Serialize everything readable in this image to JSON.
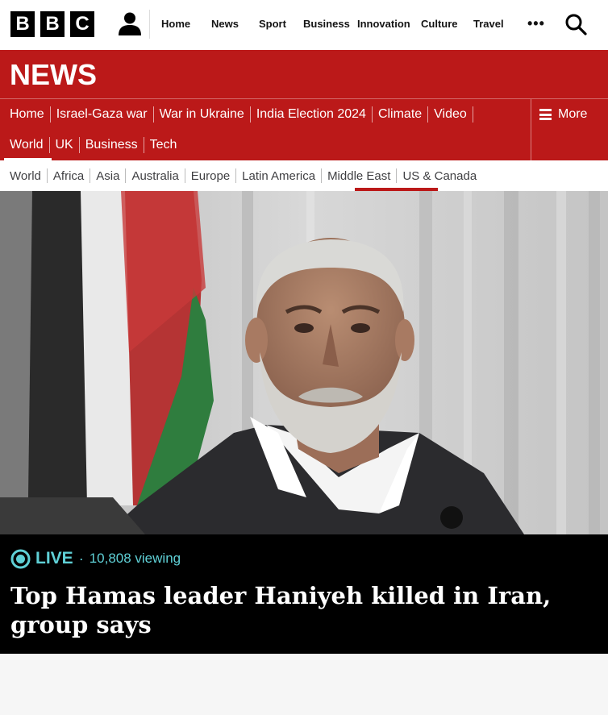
{
  "brand": {
    "letters": [
      "B",
      "B",
      "C"
    ]
  },
  "top_nav": {
    "items": [
      "Home",
      "News",
      "Sport",
      "Business",
      "Innovation",
      "Culture",
      "Travel"
    ],
    "more": "•••"
  },
  "news_header": {
    "wordmark": "NEWS"
  },
  "primary_nav": {
    "row1": [
      "Home",
      "Israel-Gaza war",
      "War in Ukraine",
      "India Election 2024",
      "Climate",
      "Video"
    ],
    "row2": [
      "World",
      "UK",
      "Business",
      "Tech"
    ],
    "active": "World",
    "more_label": "More"
  },
  "secondary_nav": {
    "items": [
      "World",
      "Africa",
      "Asia",
      "Australia",
      "Europe",
      "Latin America",
      "Middle East",
      "US & Canada"
    ],
    "active": "Middle East"
  },
  "hero": {
    "image_subject": "portrait photo of a man with grey hair and beard in dark suit, flag in background"
  },
  "story": {
    "live_label": "LIVE",
    "separator": "·",
    "viewing": "10,808 viewing",
    "headline": "Top Hamas leader Haniyeh killed in Iran, group says"
  },
  "colors": {
    "bbc_red": "#bb1919",
    "live_teal": "#5fd0d6",
    "caption_bg": "#000000"
  },
  "icons": [
    "account-icon",
    "search-icon",
    "hamburger-icon",
    "live-icon"
  ]
}
